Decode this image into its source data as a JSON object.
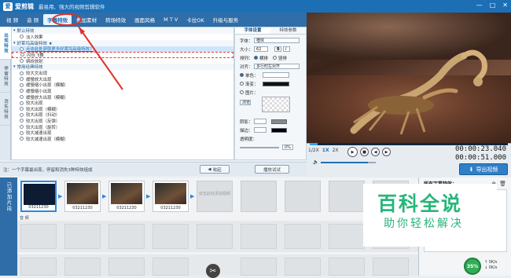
{
  "app": {
    "logo": "爱",
    "title": "爱剪辑",
    "subtitle": "最易用、强大的视频剪辑软件",
    "window_controls": [
      "—",
      "□",
      "✕"
    ]
  },
  "menu": [
    {
      "label": "视 频"
    },
    {
      "label": "音 频"
    },
    {
      "label": "字幕特效",
      "active": true
    },
    {
      "label": "叠加素材"
    },
    {
      "label": "转场特效"
    },
    {
      "label": "画面风格"
    },
    {
      "label": "M T V"
    },
    {
      "label": "卡拉OK"
    },
    {
      "label": "升级与服务"
    }
  ],
  "side_tabs": [
    "出现特效",
    "停留特效",
    "消失特效"
  ],
  "effects": {
    "groups": [
      {
        "title": "默认特效",
        "items": [
          "淡入效果"
        ]
      },
      {
        "title": "好莱坞高级特效 ★",
        "items": [
          "点击此处获取更多好莱坞高级特效！",
          "闪烁飞舞",
          "缤纷放射"
        ]
      },
      {
        "title": "常用经典特效",
        "items": [
          "较大文出现",
          "缓慢放大出现",
          "缓慢缩小出现（模糊）",
          "缓慢缩小出现",
          "缓慢放大出现（模糊）",
          "较大出现",
          "较大出现（模糊）",
          "较大出现（抖动）",
          "较大出现（反弹）",
          "较大出现（旋转）",
          "较大减速出现",
          "较大减速出现（模糊）"
        ]
      }
    ]
  },
  "settings": {
    "tabs": [
      "字体设置",
      "特效参数"
    ],
    "font_label": "字体：",
    "font_value": "楷体",
    "size_label": "大小：",
    "size_value": "62",
    "bold": "B",
    "italic": "I",
    "direction_label": "排列：",
    "dir_h": "横排",
    "dir_v": "竖排",
    "align_label": "对齐：",
    "align_value": "多行时左对齐",
    "single_color": "单色：",
    "gradient": "渐变：",
    "picture": "图片：",
    "browse": "浏览",
    "shadow_label": "阴影：",
    "outline_label": "描边：",
    "opacity_label": "透明度：",
    "opacity_value": "0%"
  },
  "preview": {
    "scene": "scorpion on soil"
  },
  "player": {
    "speeds": [
      "1/2X",
      "1X",
      "2X"
    ],
    "active_speed": "1X",
    "time_current": "00:00:23.040",
    "time_total": "00:00:51.000",
    "export_label": "导出视频"
  },
  "hint": {
    "text": "注：一个字幕最出现，停留和消失3种特效组成",
    "collapse_label": "收起",
    "play_test_label": "播放试试"
  },
  "timeline": {
    "side_label": "已添加片段",
    "clips": [
      {
        "name": "03211230"
      },
      {
        "name": "03211230"
      },
      {
        "name": "03211230"
      },
      {
        "name": "03211230"
      }
    ],
    "placeholder_text": "双击此处添加视频",
    "audio_label": "音 频"
  },
  "subs_panel": {
    "title": "所有字幕特效："
  },
  "watermark": {
    "big": "百科全说",
    "small": "助你轻松解决"
  },
  "status": {
    "cpu": "35%",
    "up": "0K/s",
    "down": "0K/s"
  }
}
